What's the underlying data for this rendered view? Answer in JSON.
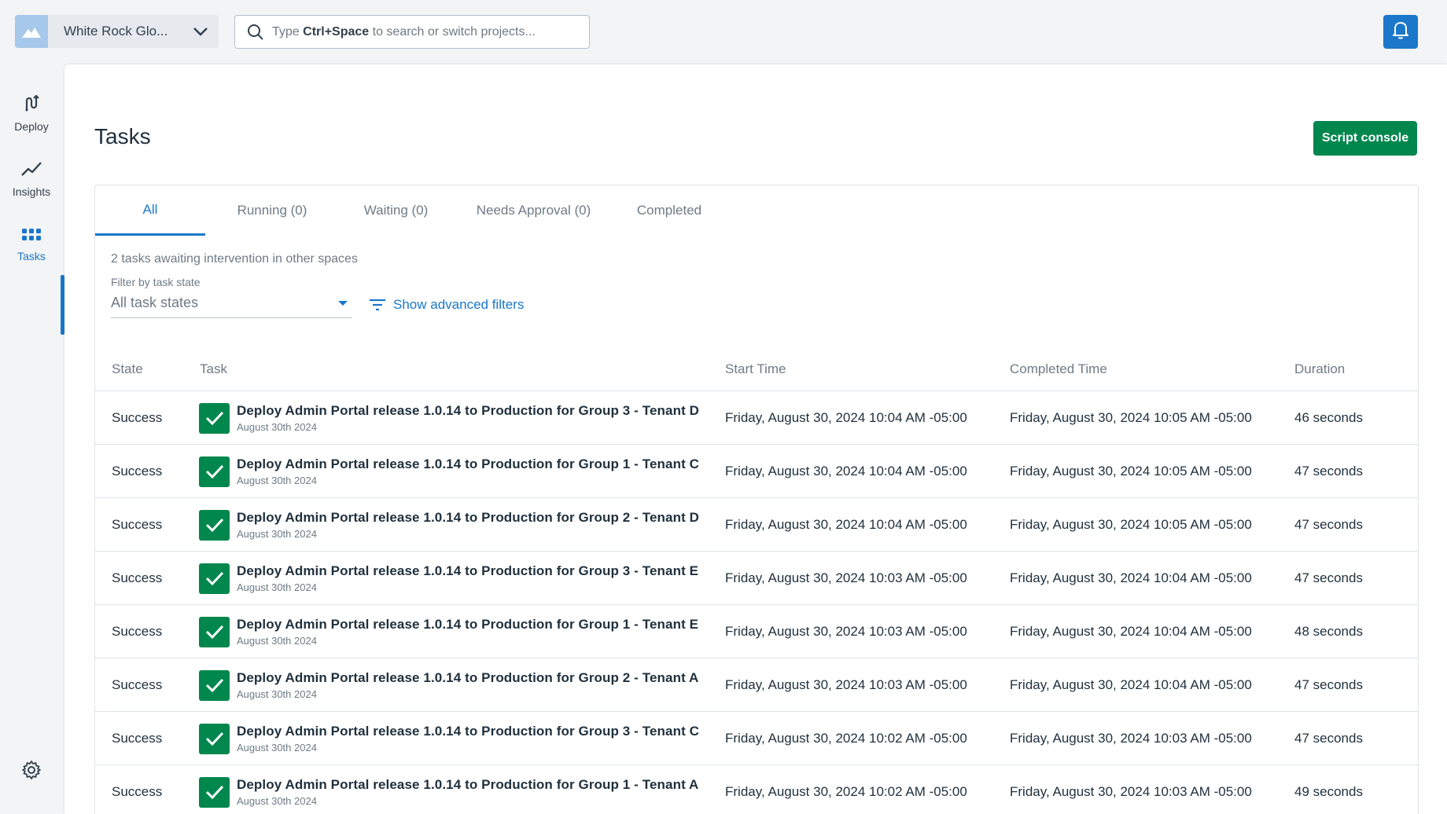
{
  "header": {
    "space_name": "White Rock Glo...",
    "search_placeholder_pre": "Type ",
    "search_placeholder_key": "Ctrl+Space",
    "search_placeholder_post": " to search or switch projects...",
    "accent_color": "#1a77ca"
  },
  "nav": {
    "items": [
      {
        "label": "Deploy",
        "icon": "deploy-icon"
      },
      {
        "label": "Insights",
        "icon": "insights-icon"
      },
      {
        "label": "Tasks",
        "icon": "tasks-icon",
        "active": true
      }
    ],
    "settings_icon": "gear-icon",
    "avatar_icon": "user-avatar"
  },
  "page": {
    "title": "Tasks",
    "script_console_label": "Script console",
    "script_console_color": "#00874d"
  },
  "tabs": [
    {
      "label": "All",
      "active": true
    },
    {
      "label": "Running (0)"
    },
    {
      "label": "Waiting (0)"
    },
    {
      "label": "Needs Approval (0)"
    },
    {
      "label": "Completed"
    }
  ],
  "filters": {
    "intervention_text": "2 tasks awaiting intervention in other spaces",
    "state_label": "Filter by task state",
    "state_value": "All task states",
    "advanced_label": "Show advanced filters"
  },
  "table": {
    "columns": [
      "State",
      "Task",
      "Start Time",
      "Completed Time",
      "Duration"
    ],
    "rows": [
      {
        "state": "Success",
        "task": "Deploy Admin Portal release 1.0.14 to Production for Group 3 - Tenant D",
        "date": "August 30th 2024",
        "start": "Friday, August 30, 2024 10:04 AM -05:00",
        "completed": "Friday, August 30, 2024 10:05 AM -05:00",
        "duration": "46 seconds"
      },
      {
        "state": "Success",
        "task": "Deploy Admin Portal release 1.0.14 to Production for Group 1 - Tenant C",
        "date": "August 30th 2024",
        "start": "Friday, August 30, 2024 10:04 AM -05:00",
        "completed": "Friday, August 30, 2024 10:05 AM -05:00",
        "duration": "47 seconds"
      },
      {
        "state": "Success",
        "task": "Deploy Admin Portal release 1.0.14 to Production for Group 2 - Tenant D",
        "date": "August 30th 2024",
        "start": "Friday, August 30, 2024 10:04 AM -05:00",
        "completed": "Friday, August 30, 2024 10:05 AM -05:00",
        "duration": "47 seconds"
      },
      {
        "state": "Success",
        "task": "Deploy Admin Portal release 1.0.14 to Production for Group 3 - Tenant E",
        "date": "August 30th 2024",
        "start": "Friday, August 30, 2024 10:03 AM -05:00",
        "completed": "Friday, August 30, 2024 10:04 AM -05:00",
        "duration": "47 seconds"
      },
      {
        "state": "Success",
        "task": "Deploy Admin Portal release 1.0.14 to Production for Group 1 - Tenant E",
        "date": "August 30th 2024",
        "start": "Friday, August 30, 2024 10:03 AM -05:00",
        "completed": "Friday, August 30, 2024 10:04 AM -05:00",
        "duration": "48 seconds"
      },
      {
        "state": "Success",
        "task": "Deploy Admin Portal release 1.0.14 to Production for Group 2 - Tenant A",
        "date": "August 30th 2024",
        "start": "Friday, August 30, 2024 10:03 AM -05:00",
        "completed": "Friday, August 30, 2024 10:04 AM -05:00",
        "duration": "47 seconds"
      },
      {
        "state": "Success",
        "task": "Deploy Admin Portal release 1.0.14 to Production for Group 3 - Tenant C",
        "date": "August 30th 2024",
        "start": "Friday, August 30, 2024 10:02 AM -05:00",
        "completed": "Friday, August 30, 2024 10:03 AM -05:00",
        "duration": "47 seconds"
      },
      {
        "state": "Success",
        "task": "Deploy Admin Portal release 1.0.14 to Production for Group 1 - Tenant A",
        "date": "August 30th 2024",
        "start": "Friday, August 30, 2024 10:02 AM -05:00",
        "completed": "Friday, August 30, 2024 10:03 AM -05:00",
        "duration": "49 seconds"
      }
    ]
  }
}
